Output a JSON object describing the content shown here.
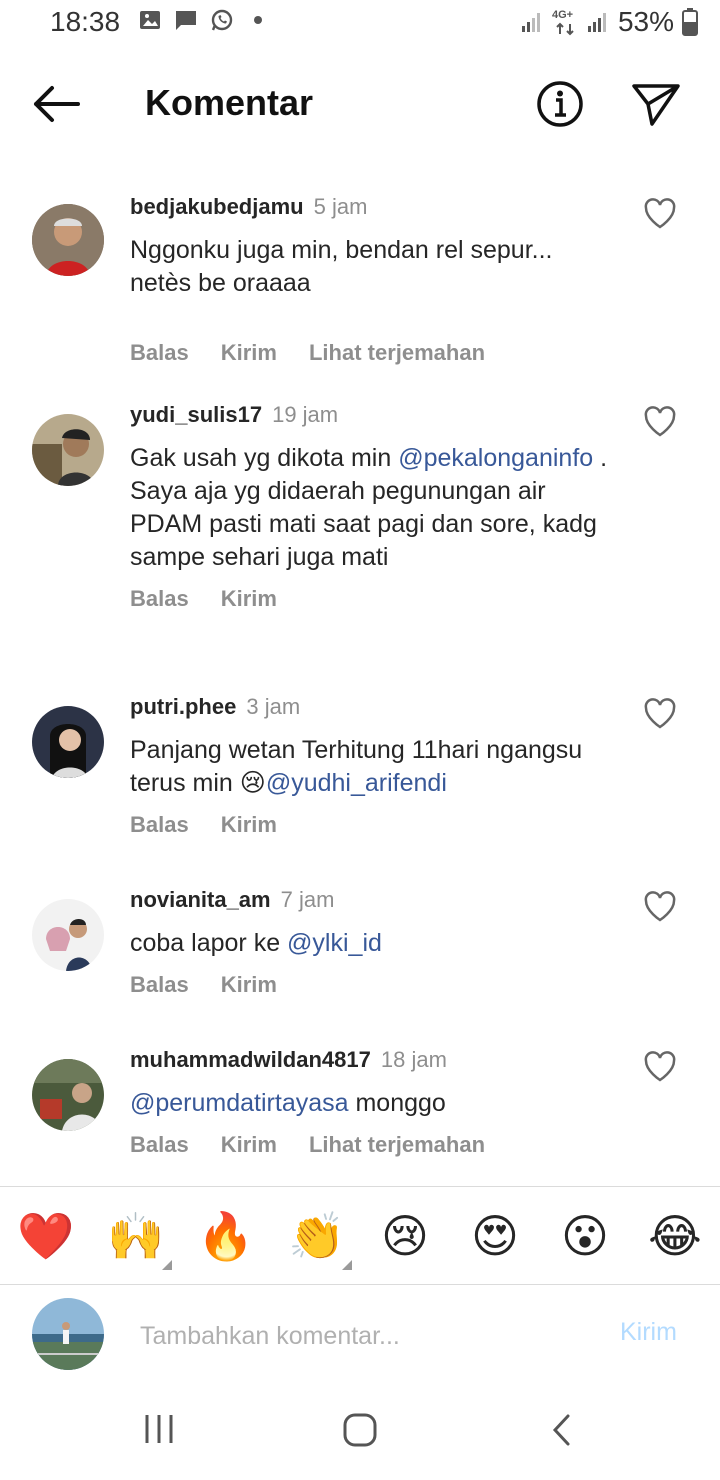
{
  "status": {
    "time": "18:38",
    "network": "4G+",
    "battery": "53%"
  },
  "header": {
    "title": "Komentar"
  },
  "comments": [
    {
      "user": "bedjakubedjamu",
      "time": "5 jam",
      "text_plain": "Nggonku juga min, bendan rel sepur... netès be oraaaa",
      "actions": [
        "Balas",
        "Kirim",
        "Lihat terjemahan"
      ]
    },
    {
      "user": "yudi_sulis17",
      "time": "19 jam",
      "text_pre": "Gak usah yg dikota min ",
      "mention": "@pekalonganinfo",
      "text_post": " . Saya aja yg didaerah pegunungan air PDAM pasti mati saat pagi dan sore, kadg sampe sehari juga mati",
      "actions": [
        "Balas",
        "Kirim"
      ]
    },
    {
      "user": "putri.phee",
      "time": "3 jam",
      "text_pre": "Panjang wetan Terhitung 11hari ngangsu terus min 😢",
      "mention": "@yudhi_arifendi",
      "actions": [
        "Balas",
        "Kirim"
      ]
    },
    {
      "user": "novianita_am",
      "time": "7 jam",
      "text_pre": "coba lapor ke ",
      "mention": "@ylki_id",
      "actions": [
        "Balas",
        "Kirim"
      ]
    },
    {
      "user": "muhammadwildan4817",
      "time": "18 jam",
      "mention": "@perumdatirtayasa",
      "text_post": " monggo",
      "actions": [
        "Balas",
        "Kirim",
        "Lihat terjemahan"
      ]
    }
  ],
  "emojis": [
    "❤️",
    "🙌",
    "🔥",
    "👏",
    "😢",
    "😍",
    "😮",
    "😂"
  ],
  "composer": {
    "placeholder": "Tambahkan komentar...",
    "post_label": "Kirim"
  },
  "icons": {
    "back": "arrow-left-icon",
    "info": "info-icon",
    "share": "paper-plane-icon",
    "like": "heart-outline-icon"
  },
  "colors": {
    "mention": "#385898",
    "secondary_text": "#8e8e8e",
    "post_button_disabled": "#b3dbff"
  }
}
